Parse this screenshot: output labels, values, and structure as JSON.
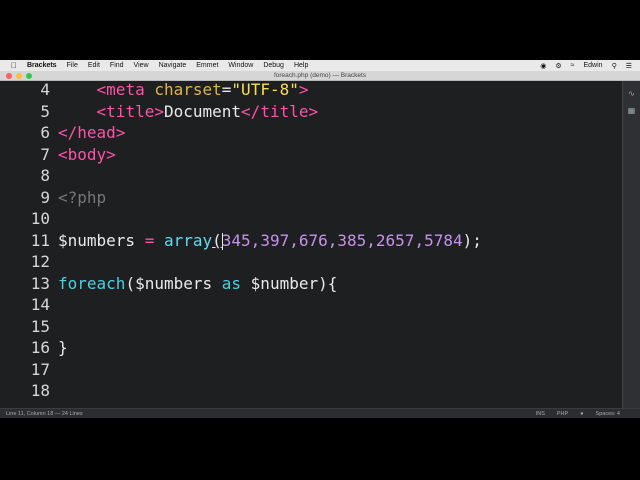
{
  "menubar": {
    "app_name": "Brackets",
    "items": [
      "File",
      "Edit",
      "Find",
      "View",
      "Navigate",
      "Emmet",
      "Window",
      "Debug",
      "Help"
    ],
    "user": "Edwin"
  },
  "window": {
    "title": "foreach.php (demo) — Brackets"
  },
  "editor": {
    "lines": [
      {
        "n": "4"
      },
      {
        "n": "5"
      },
      {
        "n": "6"
      },
      {
        "n": "7"
      },
      {
        "n": "8"
      },
      {
        "n": "9"
      },
      {
        "n": "10"
      },
      {
        "n": "11"
      },
      {
        "n": "12"
      },
      {
        "n": "13"
      },
      {
        "n": "14"
      },
      {
        "n": "15"
      },
      {
        "n": "16"
      },
      {
        "n": "17"
      },
      {
        "n": "18"
      }
    ],
    "tokens": {
      "l4_indent": "    ",
      "l4_open": "<",
      "l4_tag": "meta",
      "l4_attr": "charset",
      "l4_eq": "=",
      "l4_str": "\"UTF-8\"",
      "l4_close": ">",
      "l5_indent": "    ",
      "l5_open": "<",
      "l5_tag": "title",
      "l5_gt": ">",
      "l5_text": "Document",
      "l5_close_open": "</",
      "l5_tag2": "title",
      "l5_close": ">",
      "l6_open": "</",
      "l6_tag": "head",
      "l6_close": ">",
      "l7_open": "<",
      "l7_tag": "body",
      "l7_close": ">",
      "l9_php": "<?php",
      "l11_var": "$numbers",
      "l11_eq": " = ",
      "l11_func": "array",
      "l11_paren": "(",
      "l11_values": "345,397,676,385,2657,5784",
      "l11_end": ");",
      "l13_kw": "foreach",
      "l13_paren": "(",
      "l13_var": "$numbers",
      "l13_as": " as ",
      "l13_var2": "$number",
      "l13_end": "){",
      "l16_brace": "}"
    }
  },
  "statusbar": {
    "position": "Line 11, Column 18 — 24 Lines",
    "mode": "INS",
    "language": "PHP",
    "spaces": "Spaces: 4"
  },
  "colors": {
    "background": "#1d1f21",
    "tag": "#ff52a8",
    "attribute": "#e0b34b",
    "string": "#f7e04f",
    "keyword": "#4dd0e1",
    "number": "#c792ea"
  }
}
